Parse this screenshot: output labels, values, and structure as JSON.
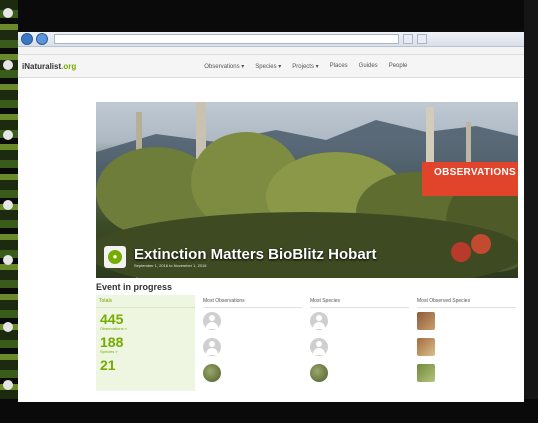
{
  "site": {
    "logo_prefix": "iNaturalist",
    "logo_suffix": ".org",
    "nav": [
      "Observations ▾",
      "Species ▾",
      "Projects ▾",
      "Places",
      "Guides",
      "People"
    ]
  },
  "project": {
    "title": "Extinction Matters BioBlitz Hobart",
    "dates": "September 1, 2016 to November 1, 2016",
    "badge_label": "OBSERVATIONS",
    "status": "Event in progress"
  },
  "totals": {
    "header": "Totals",
    "observations": "445",
    "observations_label": "Observations »",
    "species": "188",
    "species_label": "Species »",
    "third": "21"
  },
  "columns": [
    {
      "header": "Most Observations"
    },
    {
      "header": "Most Species"
    },
    {
      "header": "Most Observed Species"
    }
  ]
}
